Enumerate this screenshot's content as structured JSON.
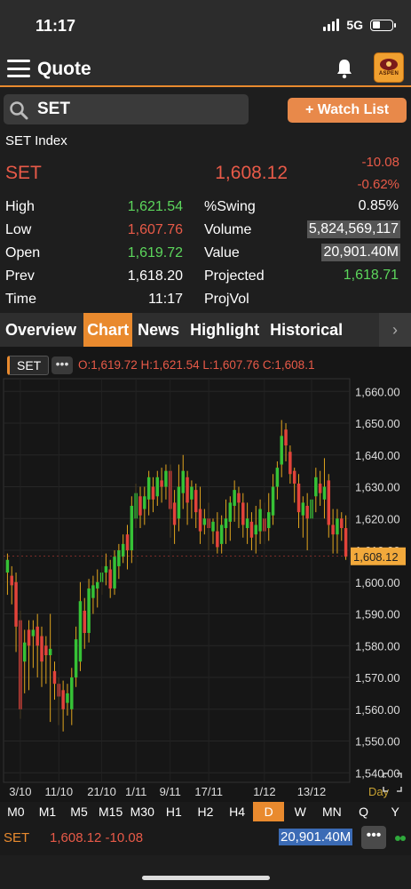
{
  "status_bar": {
    "time": "11:17",
    "network": "5G"
  },
  "header": {
    "title": "Quote",
    "logo_text": "ASPEN"
  },
  "search": {
    "value": "SET"
  },
  "watch_list_label": "+ Watch List",
  "quote": {
    "index_name": "SET Index",
    "symbol": "SET",
    "last": "1,608.12",
    "change": "-10.08",
    "change_pct": "-0.62%",
    "rows": [
      {
        "l1": "High",
        "v1": "1,621.54",
        "l2": "%Swing",
        "v2": "0.85%"
      },
      {
        "l1": "Low",
        "v1": "1,607.76",
        "l2": "Volume",
        "v2": "5,824,569,117"
      },
      {
        "l1": "Open",
        "v1": "1,619.72",
        "l2": "Value",
        "v2": "20,901.40M"
      },
      {
        "l1": "Prev",
        "v1": "1,618.20",
        "l2": "Projected",
        "v2": "1,618.71"
      },
      {
        "l1": "Time",
        "v1": "11:17",
        "l2": "ProjVol",
        "v2": ""
      }
    ]
  },
  "tabs": [
    "Overview",
    "Chart",
    "News",
    "Highlight",
    "Historical"
  ],
  "chart_header": {
    "symbol": "SET",
    "more": "•••",
    "ohlc": "O:1,619.72 H:1,621.54 L:1,607.76 C:1,608.1"
  },
  "chart_data": {
    "type": "candlestick",
    "x_tick_labels": [
      "3/10",
      "11/10",
      "21/10",
      "1/11",
      "9/11",
      "17/11",
      "1/12",
      "13/12"
    ],
    "y_tick_labels": [
      "1,660.00",
      "1,650.00",
      "1,640.00",
      "1,630.00",
      "1,620.00",
      "1,610.00",
      "1,600.00",
      "1,590.00",
      "1,580.00",
      "1,570.00",
      "1,560.00",
      "1,550.00",
      "1,540.00"
    ],
    "ylim": [
      1537,
      1664
    ],
    "last_price_label": "1,608.12",
    "period_label": "Day",
    "candles": [
      [
        1603,
        1607,
        1596,
        1609
      ],
      [
        1602,
        1599,
        1593,
        1605
      ],
      [
        1600,
        1586,
        1578,
        1603
      ],
      [
        1588,
        1560,
        1557,
        1591
      ],
      [
        1575,
        1581,
        1565,
        1585
      ],
      [
        1585,
        1580,
        1566,
        1588
      ],
      [
        1583,
        1585,
        1573,
        1588
      ],
      [
        1586,
        1580,
        1570,
        1590
      ],
      [
        1583,
        1575,
        1567,
        1586
      ],
      [
        1580,
        1577,
        1568,
        1583
      ],
      [
        1577,
        1579,
        1556,
        1590
      ],
      [
        1572,
        1568,
        1563,
        1575
      ],
      [
        1568,
        1564,
        1555,
        1570
      ],
      [
        1566,
        1560,
        1553,
        1569
      ],
      [
        1562,
        1565,
        1558,
        1568
      ],
      [
        1560,
        1570,
        1555,
        1573
      ],
      [
        1570,
        1582,
        1567,
        1586
      ],
      [
        1575,
        1594,
        1572,
        1600
      ],
      [
        1591,
        1584,
        1579,
        1595
      ],
      [
        1584,
        1598,
        1581,
        1601
      ],
      [
        1595,
        1599,
        1590,
        1602
      ],
      [
        1598,
        1600,
        1592,
        1604
      ],
      [
        1600,
        1603,
        1596,
        1605
      ],
      [
        1603,
        1605,
        1599,
        1609
      ],
      [
        1604,
        1598,
        1595,
        1607
      ],
      [
        1598,
        1608,
        1596,
        1610
      ],
      [
        1605,
        1610,
        1601,
        1612
      ],
      [
        1608,
        1612,
        1606,
        1615
      ],
      [
        1615,
        1610,
        1604,
        1618
      ],
      [
        1610,
        1624,
        1606,
        1627
      ],
      [
        1620,
        1628,
        1617,
        1631
      ],
      [
        1627,
        1621,
        1617,
        1630
      ],
      [
        1623,
        1627,
        1618,
        1630
      ],
      [
        1626,
        1633,
        1621,
        1635
      ],
      [
        1630,
        1626,
        1622,
        1633
      ],
      [
        1627,
        1633,
        1624,
        1635
      ],
      [
        1632,
        1630,
        1625,
        1636
      ],
      [
        1630,
        1635,
        1626,
        1637
      ],
      [
        1635,
        1623,
        1614,
        1637
      ],
      [
        1625,
        1618,
        1612,
        1629
      ],
      [
        1620,
        1630,
        1616,
        1637
      ],
      [
        1628,
        1635,
        1623,
        1640
      ],
      [
        1633,
        1625,
        1618,
        1635
      ],
      [
        1626,
        1630,
        1620,
        1632
      ],
      [
        1629,
        1622,
        1617,
        1631
      ],
      [
        1623,
        1616,
        1612,
        1630
      ],
      [
        1618,
        1620,
        1615,
        1623
      ],
      [
        1620,
        1617,
        1610,
        1625
      ],
      [
        1616,
        1619,
        1612,
        1620
      ],
      [
        1616,
        1611,
        1609,
        1622
      ],
      [
        1612,
        1618,
        1609,
        1621
      ],
      [
        1617,
        1620,
        1612,
        1626
      ],
      [
        1619,
        1625,
        1613,
        1627
      ],
      [
        1624,
        1629,
        1619,
        1632
      ],
      [
        1628,
        1625,
        1617,
        1630
      ],
      [
        1625,
        1618,
        1614,
        1628
      ],
      [
        1617,
        1620,
        1612,
        1625
      ],
      [
        1619,
        1614,
        1610,
        1622
      ],
      [
        1615,
        1618,
        1609,
        1624
      ],
      [
        1616,
        1623,
        1612,
        1626
      ],
      [
        1620,
        1616,
        1612,
        1625
      ],
      [
        1617,
        1622,
        1613,
        1628
      ],
      [
        1621,
        1630,
        1618,
        1634
      ],
      [
        1630,
        1636,
        1626,
        1638
      ],
      [
        1637,
        1646,
        1633,
        1651
      ],
      [
        1648,
        1643,
        1638,
        1650
      ],
      [
        1641,
        1634,
        1631,
        1643
      ],
      [
        1635,
        1631,
        1625,
        1636
      ],
      [
        1631,
        1622,
        1617,
        1634
      ],
      [
        1621,
        1625,
        1614,
        1627
      ],
      [
        1624,
        1620,
        1610,
        1628
      ],
      [
        1620,
        1626,
        1616,
        1628
      ],
      [
        1627,
        1633,
        1622,
        1636
      ],
      [
        1631,
        1628,
        1624,
        1635
      ],
      [
        1626,
        1630,
        1620,
        1639
      ],
      [
        1632,
        1618,
        1614,
        1634
      ],
      [
        1618,
        1615,
        1609,
        1623
      ],
      [
        1615,
        1620,
        1609,
        1623
      ],
      [
        1620,
        1617,
        1613,
        1622
      ],
      [
        1617,
        1608,
        1607,
        1621
      ]
    ]
  },
  "timeframes": [
    "M0",
    "M1",
    "M5",
    "M15",
    "M30",
    "H1",
    "H2",
    "H4",
    "D",
    "W",
    "MN",
    "Q",
    "Y"
  ],
  "active_timeframe": "D",
  "ticker": {
    "symbol": "SET",
    "price_change": "1,608.12 -10.08",
    "value": "20,901.40M",
    "more": "•••"
  }
}
